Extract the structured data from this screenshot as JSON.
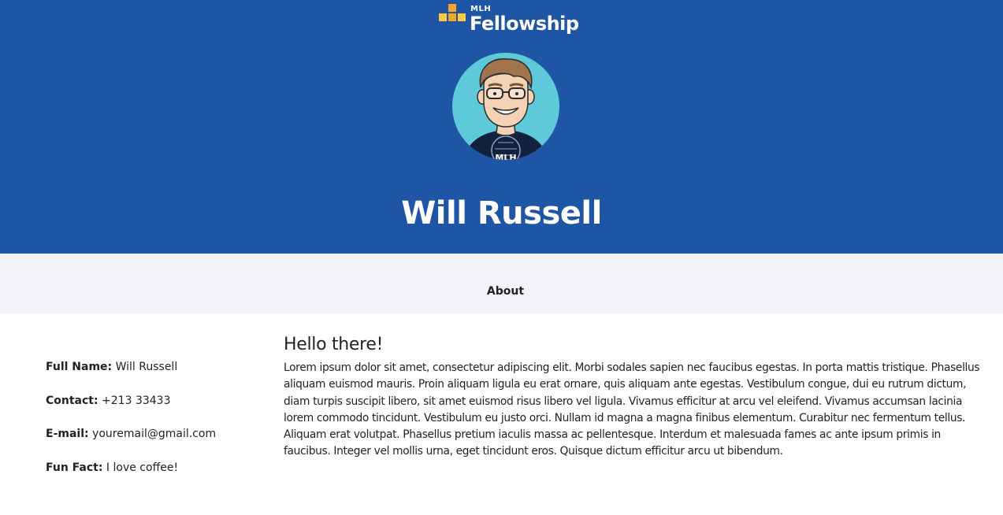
{
  "brand": {
    "small_label": "MLH",
    "big_label": "Fellowship",
    "colors": {
      "square_orange": "#f5a623",
      "square_yellow": "#fcc840"
    }
  },
  "header": {
    "background": "#1f55a5",
    "avatar_icon": "cartoon-avatar-icon",
    "avatar_shirt_text": "MLH",
    "name": "Will Russell"
  },
  "nav": {
    "about_label": "About"
  },
  "profile": {
    "items": [
      {
        "label": "Full Name:",
        "value": "Will Russell"
      },
      {
        "label": "Contact:",
        "value": "+213 33433"
      },
      {
        "label": "E-mail:",
        "value": "youremail@gmail.com"
      },
      {
        "label": "Fun Fact:",
        "value": "I love coffee!"
      }
    ]
  },
  "about": {
    "heading": "Hello there!",
    "body": "Lorem ipsum dolor sit amet, consectetur adipiscing elit. Morbi sodales sapien nec faucibus egestas. In porta mattis tristique. Phasellus aliquam euismod mauris. Proin aliquam ligula eu erat ornare, quis aliquam ante egestas. Vestibulum congue, dui eu rutrum dictum, diam turpis suscipit libero, sit amet euismod risus libero vel ligula. Vivamus efficitur at arcu vel eleifend. Vivamus accumsan lacinia lorem commodo tincidunt. Vestibulum eu justo orci. Nullam id magna a magna finibus elementum. Curabitur nec fermentum tellus. Aliquam erat volutpat. Phasellus pretium iaculis massa ac pellentesque. Interdum et malesuada fames ac ante ipsum primis in faucibus. Integer vel mollis urna, eget tincidunt eros. Quisque dictum efficitur arcu ut bibendum."
  }
}
